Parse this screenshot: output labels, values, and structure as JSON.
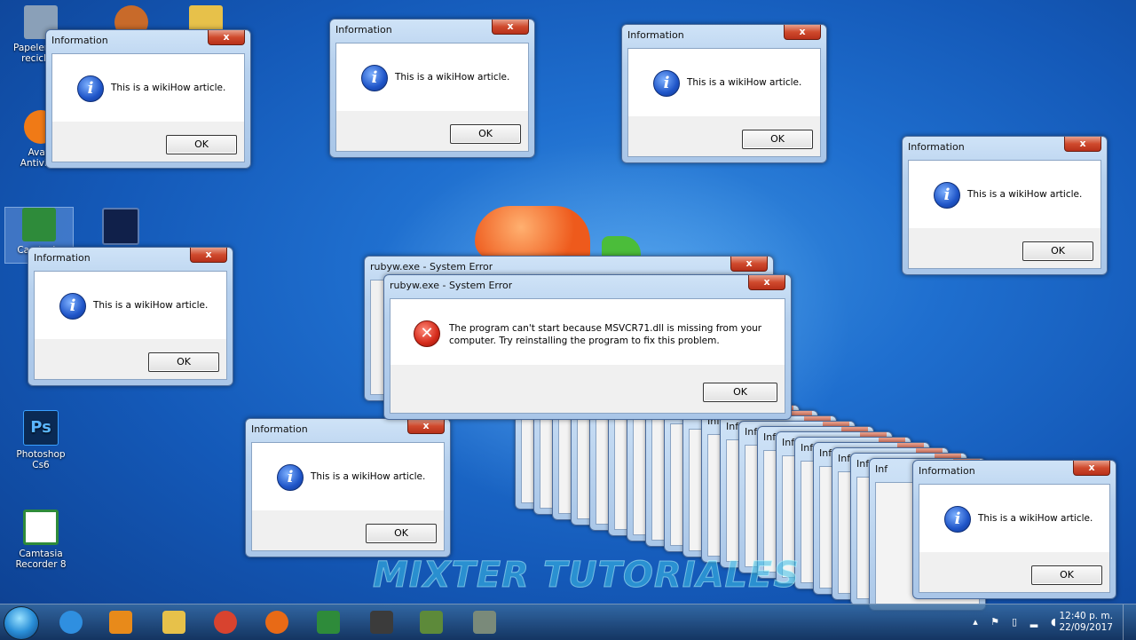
{
  "desktop_icons": [
    {
      "id": "recycle",
      "label": "Papelera de reciclaje",
      "color": "#8aa0b8"
    },
    {
      "id": "avast",
      "label": "Avast Antivirus",
      "color": "#f07a16"
    },
    {
      "id": "camtasia",
      "label": "Camtasia",
      "color": "#2e8b3a"
    },
    {
      "id": "photoshop",
      "label": "Photoshop Cs6",
      "color": "#0a2a55"
    },
    {
      "id": "camtasia-recorder",
      "label": "Camtasia Recorder 8",
      "color": "#2e8b3a"
    }
  ],
  "info_dialog": {
    "title": "Information",
    "message": "This is a wikiHow article.",
    "ok": "OK",
    "close": "x"
  },
  "error_dialog": {
    "title": "rubyw.exe - System Error",
    "message": "The program can't start because MSVCR71.dll is missing from your computer. Try reinstalling the program to fix this problem.",
    "ok": "OK",
    "close": "x"
  },
  "stack_title_fragment": "Information",
  "stack_short": "Inf",
  "watermark": "MIXTER TUTORIALES",
  "taskbar": {
    "apps": [
      {
        "name": "internet-explorer",
        "color": "#2f8fe0"
      },
      {
        "name": "media-player",
        "color": "#e88a1a"
      },
      {
        "name": "file-explorer",
        "color": "#e7c14a"
      },
      {
        "name": "chrome",
        "color": "#d8432f"
      },
      {
        "name": "firefox",
        "color": "#e86a16"
      },
      {
        "name": "camtasia",
        "color": "#2e8b3a"
      },
      {
        "name": "minecraft-mw",
        "color": "#3b3b3b"
      },
      {
        "name": "minecraft",
        "color": "#5d8a3a"
      },
      {
        "name": "gta-v",
        "color": "#7a8a7a"
      }
    ],
    "time": "12:40 p. m.",
    "date": "22/09/2017"
  },
  "colors": {
    "accent": "#1f6fcf",
    "close": "#c8402a"
  }
}
